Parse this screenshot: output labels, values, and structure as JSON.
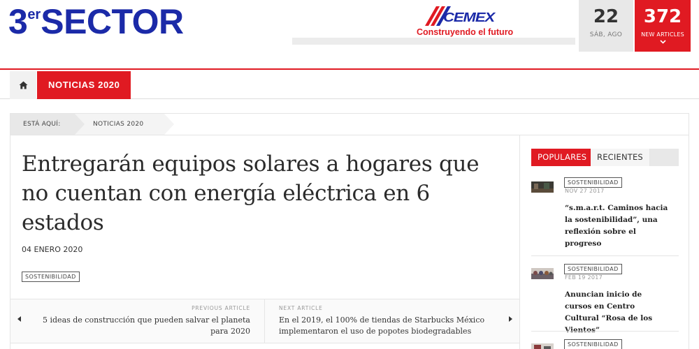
{
  "header": {
    "logo_main": "3",
    "logo_sup": "er",
    "logo_rest": "SECTOR",
    "ad": {
      "brand": "CEMEX",
      "tagline": "Construyendo el futuro"
    },
    "date": {
      "day": "22",
      "label": "SÁB, AGO"
    },
    "articles": {
      "count": "372",
      "label": "NEW ARTICLES",
      "icon": "chevron-down-icon"
    }
  },
  "nav": {
    "home_icon": "home-icon",
    "tab": "NOTICIAS 2020"
  },
  "breadcrumb": {
    "here_label": "ESTÁ AQUÍ:",
    "current": "NOTICIAS 2020"
  },
  "article": {
    "title": "Entregarán equipos solares a hogares que no cuentan con energía eléctrica en 6 estados",
    "date": "04 ENERO 2020",
    "category": "SOSTENIBILIDAD"
  },
  "pager": {
    "prev_caption": "PREVIOUS ARTICLE",
    "prev_title": "5 ideas de construcción que pueden salvar el planeta para 2020",
    "next_caption": "NEXT ARTICLE",
    "next_title": "En el 2019, el 100% de tiendas de Starbucks México implementaron el uso de popotes biodegradables"
  },
  "sidebar": {
    "tabs": [
      "POPULARES",
      "RECIENTES"
    ],
    "posts": [
      {
        "category": "SOSTENIBILIDAD",
        "date": "NOV 27 2017",
        "title": "“s.m.a.r.t. Caminos hacia la sostenibilidad”, una reflexión sobre el progreso"
      },
      {
        "category": "SOSTENIBILIDAD",
        "date": "FEB 19 2017",
        "title": "Anuncian inicio de cursos en Centro Cultural “Rosa de los Vientos”"
      },
      {
        "category": "SOSTENIBILIDAD",
        "date": "",
        "title": ""
      }
    ]
  },
  "colors": {
    "accent": "#e01a22",
    "brand_blue": "#1b2aa8"
  }
}
